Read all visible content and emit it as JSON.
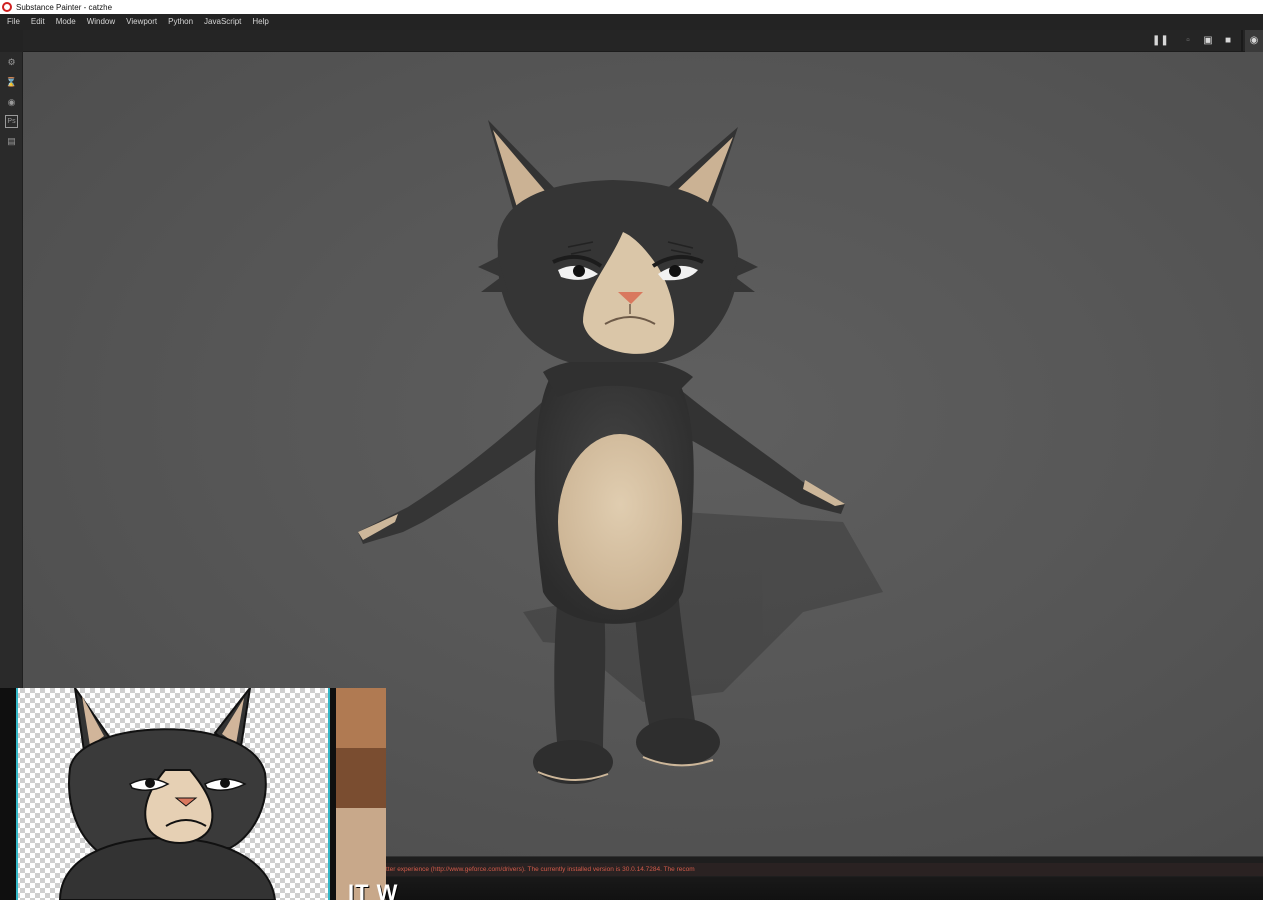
{
  "window": {
    "title": "Substance Painter - catzhe"
  },
  "menu": {
    "items": [
      "File",
      "Edit",
      "Mode",
      "Window",
      "Viewport",
      "Python",
      "JavaScript",
      "Help"
    ]
  },
  "toolbar": {
    "icons": [
      "pause-icon",
      "frame-icon",
      "cube-view-icon",
      "camera-icon",
      "screenshot-icon"
    ]
  },
  "left_tools": {
    "icons": [
      "settings-icon",
      "history-icon",
      "shelf-icon",
      "photoshop-icon",
      "export-icon"
    ],
    "photoshop_label": "Ps"
  },
  "log": {
    "message": "tter experience (http://www.geforce.com/drivers). The currently installed version is 30.0.14.7284. The recom"
  },
  "overlay": {
    "caption": "IT W"
  },
  "colors": {
    "viewport_bg": "#575757",
    "menubar_bg": "#232323",
    "fur_dark": "#363636",
    "fur_light": "#d8c3a5",
    "nose": "#d9785e",
    "log_error": "#d25b4a"
  }
}
